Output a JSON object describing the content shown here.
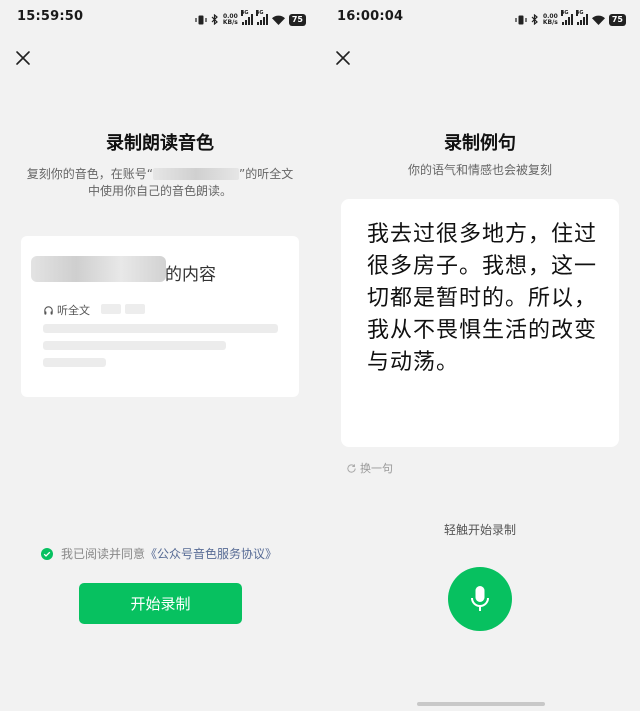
{
  "left": {
    "status": {
      "time": "15:59:50",
      "netspeed": "0.00",
      "netunit": "KB/s",
      "net_type": "4G",
      "battery": "75"
    },
    "title": "录制朗读音色",
    "desc_prefix": "复刻你的音色，在账号“",
    "desc_suffix": "”的听全文中使用你自己的音色朗读。",
    "card": {
      "title_suffix": "的内容",
      "listen_label": "听全文"
    },
    "agree": {
      "text": "我已阅读并同意",
      "link": "《公众号音色服务协议》"
    },
    "start_button": "开始录制"
  },
  "right": {
    "status": {
      "time": "16:00:04",
      "netspeed": "0.00",
      "netunit": "KB/s",
      "net_type": "4G",
      "battery": "75"
    },
    "title": "录制例句",
    "subtitle": "你的语气和情感也会被复刻",
    "sentence": "我去过很多地方，住过很多房子。我想，这一切都是暂时的。所以，我从不畏惧生活的改变与动荡。",
    "swap_label": "换一句",
    "hint": "轻触开始录制"
  },
  "colors": {
    "accent": "#07c160",
    "link": "#576b95",
    "background": "#f2f2f2"
  },
  "icons": [
    "close-icon",
    "headphones-icon",
    "check-icon",
    "refresh-icon",
    "microphone-icon",
    "vibrate-icon",
    "bluetooth-icon",
    "signal-icon",
    "wifi-icon",
    "battery-icon"
  ]
}
